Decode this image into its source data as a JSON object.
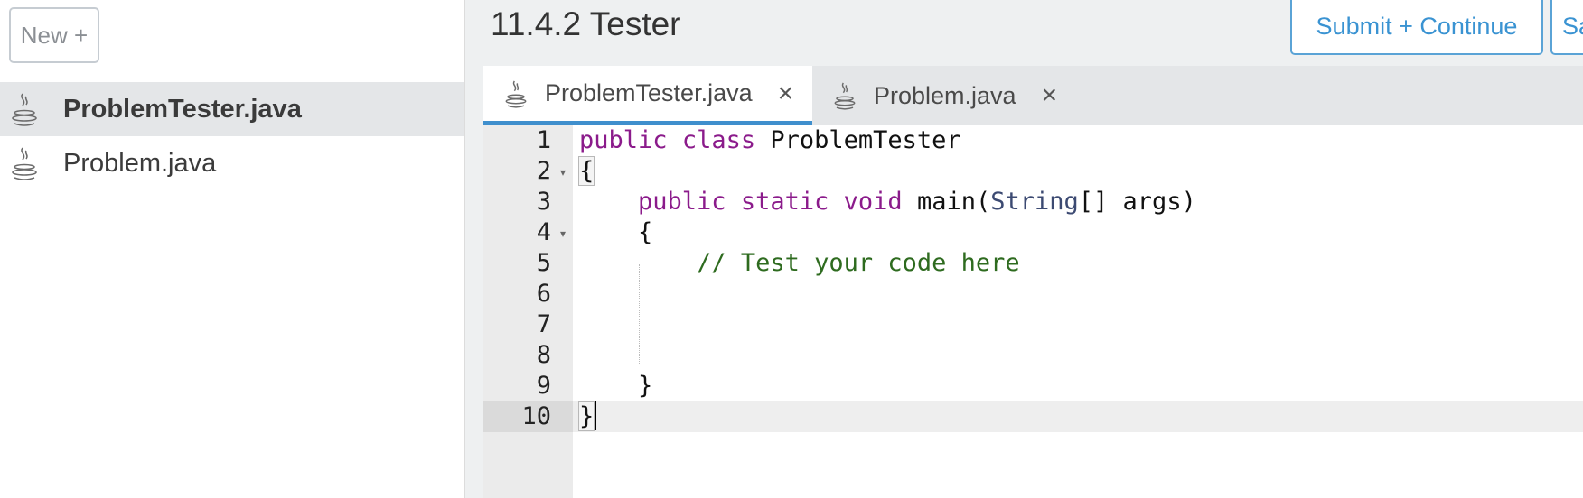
{
  "sidebar": {
    "new_button": "New +",
    "files": [
      {
        "name": "ProblemTester.java",
        "icon": "java-icon",
        "active": true
      },
      {
        "name": "Problem.java",
        "icon": "java-icon",
        "active": false
      }
    ]
  },
  "header": {
    "title": "11.4.2 Tester",
    "submit_label": "Submit + Continue",
    "save_label": "Save"
  },
  "tabs": [
    {
      "label": "ProblemTester.java",
      "icon": "java-icon",
      "close": "×",
      "active": true
    },
    {
      "label": "Problem.java",
      "icon": "java-icon",
      "close": "×",
      "active": false
    }
  ],
  "editor": {
    "line_numbers": [
      "1",
      "2",
      "3",
      "4",
      "5",
      "6",
      "7",
      "8",
      "9",
      "10"
    ],
    "active_line": 10,
    "lines": [
      {
        "tokens": [
          {
            "t": "public",
            "c": "kw"
          },
          {
            "t": " "
          },
          {
            "t": "class",
            "c": "kw"
          },
          {
            "t": " ProblemTester"
          }
        ]
      },
      {
        "tokens": [
          {
            "t": "{"
          }
        ]
      },
      {
        "tokens": [
          {
            "t": "    "
          },
          {
            "t": "public",
            "c": "kw"
          },
          {
            "t": " "
          },
          {
            "t": "static",
            "c": "kw"
          },
          {
            "t": " "
          },
          {
            "t": "void",
            "c": "kw"
          },
          {
            "t": " main("
          },
          {
            "t": "String",
            "c": "ty"
          },
          {
            "t": "[] args)"
          }
        ]
      },
      {
        "tokens": [
          {
            "t": "    {"
          }
        ]
      },
      {
        "tokens": [
          {
            "t": "        "
          },
          {
            "t": "// Test your code here",
            "c": "cm"
          }
        ]
      },
      {
        "tokens": [
          {
            "t": ""
          }
        ]
      },
      {
        "tokens": [
          {
            "t": ""
          }
        ]
      },
      {
        "tokens": [
          {
            "t": ""
          }
        ]
      },
      {
        "tokens": [
          {
            "t": "    }"
          }
        ]
      },
      {
        "tokens": [
          {
            "t": "}"
          }
        ]
      }
    ]
  },
  "colors": {
    "accent": "#3f8fcd",
    "keyword": "#8b1b8b",
    "type": "#3c4a72",
    "comment": "#2e6b1f"
  }
}
